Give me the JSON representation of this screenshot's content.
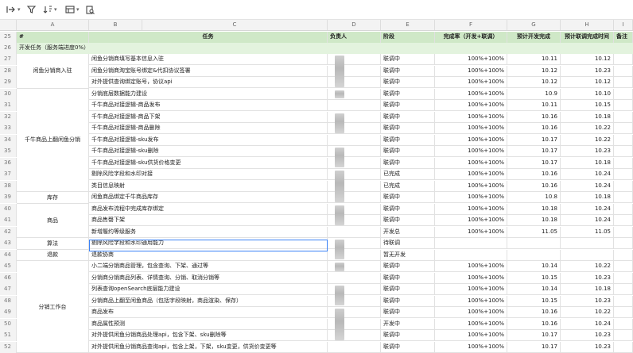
{
  "toolbar": {
    "items": [
      "indent-icon",
      "filter-icon",
      "sort-icon",
      "view-icon",
      "find-icon"
    ]
  },
  "columns": [
    "A",
    "B",
    "C",
    "D",
    "E",
    "F",
    "G",
    "H",
    "I"
  ],
  "header_row": {
    "row_num": "25",
    "hash": "#",
    "task": "任务",
    "owner": "负责人",
    "stage": "阶段",
    "completion": "完成率（开发+联调）",
    "dev_done": "预计开发完成",
    "debug_done": "预计联调完成时间",
    "note": "备注"
  },
  "section_row": {
    "row_num": "26",
    "label": "开发任务（服务端进度0%）"
  },
  "groups": [
    {
      "label": "闲鱼分销商入驻",
      "start": 27,
      "span": 3
    },
    {
      "label": "千牛商品上翻闲鱼分销",
      "start": 30,
      "span": 9
    },
    {
      "label": "库存",
      "start": 39,
      "span": 1
    },
    {
      "label": "商品",
      "start": 40,
      "span": 3
    },
    {
      "label": "算法",
      "start": 43,
      "span": 1
    },
    {
      "label": "退款",
      "start": 44,
      "span": 1
    },
    {
      "label": "分销工作台",
      "start": 45,
      "span": 8
    }
  ],
  "rows": [
    {
      "n": "27",
      "task": "闲鱼分销商填写基本信息入驻",
      "stage": "联调中",
      "rate": "100%+100%",
      "dev": "10.11",
      "dbg": "10.12"
    },
    {
      "n": "28",
      "task": "闲鱼分销商淘宝账号绑定&代扣协议签署",
      "stage": "联调中",
      "rate": "100%+100%",
      "dev": "10.12",
      "dbg": "10.23"
    },
    {
      "n": "29",
      "task": "对外提供查询绑定账号，协议api",
      "stage": "联调中",
      "rate": "100%+100%",
      "dev": "10.12",
      "dbg": "10.12"
    },
    {
      "n": "30",
      "task": "分销底层数据能力建设",
      "stage": "联调中",
      "rate": "100%+100%",
      "dev": "10.9",
      "dbg": "10.10"
    },
    {
      "n": "31",
      "task": "千牛商品对接逻辑-商品发布",
      "stage": "联调中",
      "rate": "100%+100%",
      "dev": "10.11",
      "dbg": "10.15"
    },
    {
      "n": "32",
      "task": "千牛商品对接逻辑-商品下架",
      "stage": "联调中",
      "rate": "100%+100%",
      "dev": "10.16",
      "dbg": "10.18"
    },
    {
      "n": "33",
      "task": "千牛商品对接逻辑-商品删除",
      "stage": "联调中",
      "rate": "100%+100%",
      "dev": "10.16",
      "dbg": "10.22"
    },
    {
      "n": "34",
      "task": "千牛商品对接逻辑-sku发布",
      "stage": "联调中",
      "rate": "100%+100%",
      "dev": "10.17",
      "dbg": "10.22"
    },
    {
      "n": "35",
      "task": "千牛商品对接逻辑-sku删除",
      "stage": "联调中",
      "rate": "100%+100%",
      "dev": "10.17",
      "dbg": "10.23"
    },
    {
      "n": "36",
      "task": "千牛商品对接逻辑-sku供货价格变更",
      "stage": "联调中",
      "rate": "100%+100%",
      "dev": "10.17",
      "dbg": "10.18"
    },
    {
      "n": "37",
      "task": "剔除风险字段和水印对接",
      "stage": "已完成",
      "rate": "100%+100%",
      "dev": "10.16",
      "dbg": "10.24"
    },
    {
      "n": "38",
      "task": "类目信息映射",
      "stage": "已完成",
      "rate": "100%+100%",
      "dev": "10.16",
      "dbg": "10.24"
    },
    {
      "n": "39",
      "task": "闲鱼商品绑定千牛商品库存",
      "stage": "联调中",
      "rate": "100%+100%",
      "dev": "10.8",
      "dbg": "10.18"
    },
    {
      "n": "40",
      "task": "商品发布流程中完成库存绑定",
      "stage": "联调中",
      "rate": "100%+100%",
      "dev": "10.18",
      "dbg": "10.24"
    },
    {
      "n": "41",
      "task": "商品售罄下架",
      "stage": "联调中",
      "rate": "100%+100%",
      "dev": "10.18",
      "dbg": "10.24"
    },
    {
      "n": "42",
      "task": "新增履约等级服务",
      "stage": "开发总",
      "rate": "100%+100%",
      "dev": "11.05",
      "dbg": "11.05"
    },
    {
      "n": "43",
      "task": "剔除风险字段和水印通用能力",
      "stage": "待联调",
      "rate": "",
      "dev": "",
      "dbg": ""
    },
    {
      "n": "44",
      "task": "退款协商",
      "stage": "暂无开发",
      "rate": "",
      "dev": "",
      "dbg": ""
    },
    {
      "n": "45",
      "task": "小二端分销商品管理，包含查询、下架、通过等",
      "stage": "联调中",
      "rate": "100%+100%",
      "dev": "10.14",
      "dbg": "10.22"
    },
    {
      "n": "46",
      "task": "分销商分销商品列表、详情查询、分销、取消分销等",
      "stage": "联调中",
      "rate": "100%+100%",
      "dev": "10.15",
      "dbg": "10.23"
    },
    {
      "n": "47",
      "task": "列表查询openSearch底层能力建设",
      "stage": "联调中",
      "rate": "100%+100%",
      "dev": "10.14",
      "dbg": "10.18"
    },
    {
      "n": "48",
      "task": "分销商品上翻至闲鱼商品（包括字段映射，商品渲染、保存）",
      "stage": "联调中",
      "rate": "100%+100%",
      "dev": "10.15",
      "dbg": "10.23"
    },
    {
      "n": "49",
      "task": "商品发布",
      "stage": "联调中",
      "rate": "100%+100%",
      "dev": "10.16",
      "dbg": "10.22"
    },
    {
      "n": "50",
      "task": "商品属性预测",
      "stage": "开发中",
      "rate": "100%+100%",
      "dev": "10.16",
      "dbg": "10.24"
    },
    {
      "n": "51",
      "task": "对外提供闲鱼分销商品处理api，包含下架、sku删除等",
      "stage": "联调中",
      "rate": "100%+100%",
      "dev": "10.17",
      "dbg": "10.23"
    },
    {
      "n": "52",
      "task": "对外提供闲鱼分销商品查询api，包含上架，下架，sku变更，供货价变更等",
      "stage": "联调中",
      "rate": "100%+100%",
      "dev": "10.17",
      "dbg": "10.23"
    }
  ],
  "colors": {
    "header_green": "#cfe8c7",
    "section_green": "#e3f3de",
    "selection": "#3b82f6"
  }
}
